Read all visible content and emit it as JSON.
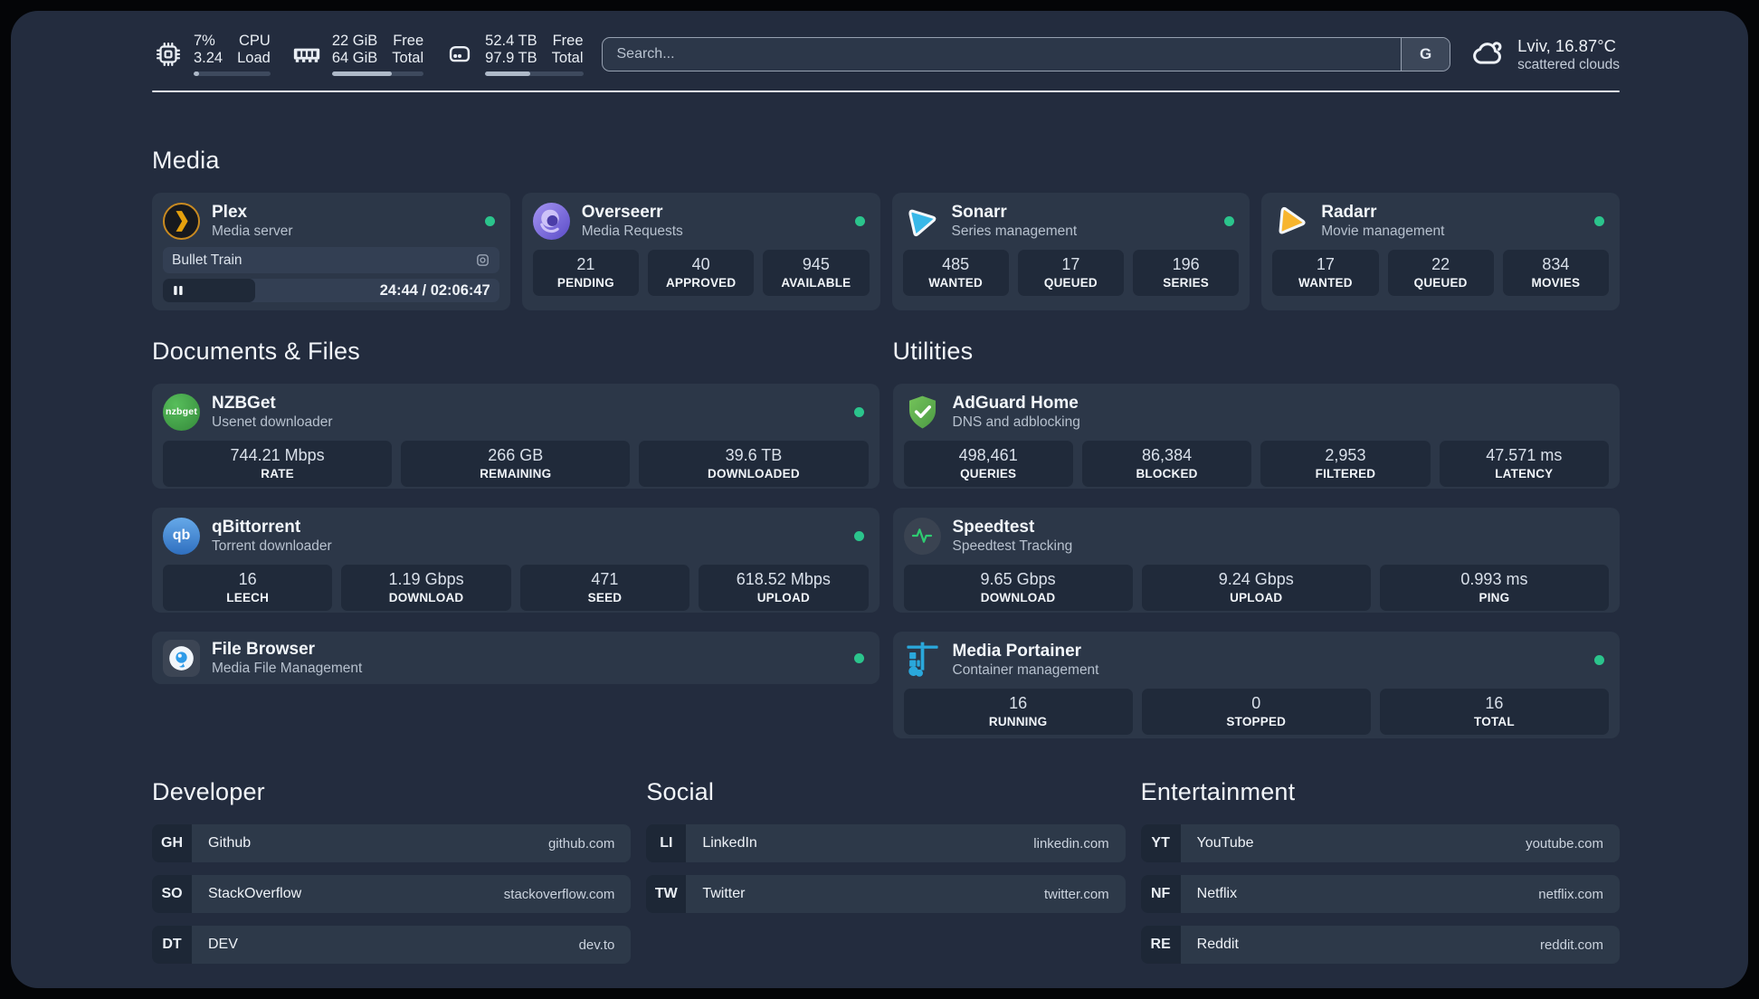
{
  "topbar": {
    "cpu": {
      "value_top": "7%",
      "value_bottom": "3.24",
      "label_top": "CPU",
      "label_bottom": "Load",
      "progress_pct": 7
    },
    "ram": {
      "value_top": "22 GiB",
      "value_bottom": "64 GiB",
      "label_top": "Free",
      "label_bottom": "Total",
      "progress_pct": 65
    },
    "disk": {
      "value_top": "52.4 TB",
      "value_bottom": "97.9 TB",
      "label_top": "Free",
      "label_bottom": "Total",
      "progress_pct": 46
    },
    "search": {
      "placeholder": "Search...",
      "button_label": "G"
    },
    "weather": {
      "location_temp": "Lviv, 16.87°C",
      "condition": "scattered clouds"
    }
  },
  "icon_text": {
    "nzbget": "nzbget",
    "qbittorrent": "qb"
  },
  "sections": {
    "media": {
      "title": "Media",
      "plex": {
        "title": "Plex",
        "subtitle": "Media server",
        "now_playing": {
          "title": "Bullet Train",
          "time": "24:44 / 02:06:47"
        }
      },
      "overseerr": {
        "title": "Overseerr",
        "subtitle": "Media Requests",
        "stats": [
          {
            "value": "21",
            "label": "PENDING"
          },
          {
            "value": "40",
            "label": "APPROVED"
          },
          {
            "value": "945",
            "label": "AVAILABLE"
          }
        ]
      },
      "sonarr": {
        "title": "Sonarr",
        "subtitle": "Series management",
        "stats": [
          {
            "value": "485",
            "label": "WANTED"
          },
          {
            "value": "17",
            "label": "QUEUED"
          },
          {
            "value": "196",
            "label": "SERIES"
          }
        ]
      },
      "radarr": {
        "title": "Radarr",
        "subtitle": "Movie management",
        "stats": [
          {
            "value": "17",
            "label": "WANTED"
          },
          {
            "value": "22",
            "label": "QUEUED"
          },
          {
            "value": "834",
            "label": "MOVIES"
          }
        ]
      }
    },
    "documents": {
      "title": "Documents & Files",
      "nzbget": {
        "title": "NZBGet",
        "subtitle": "Usenet downloader",
        "stats": [
          {
            "value": "744.21 Mbps",
            "label": "RATE"
          },
          {
            "value": "266 GB",
            "label": "REMAINING"
          },
          {
            "value": "39.6 TB",
            "label": "DOWNLOADED"
          }
        ]
      },
      "qbittorrent": {
        "title": "qBittorrent",
        "subtitle": "Torrent downloader",
        "stats": [
          {
            "value": "16",
            "label": "LEECH"
          },
          {
            "value": "1.19 Gbps",
            "label": "DOWNLOAD"
          },
          {
            "value": "471",
            "label": "SEED"
          },
          {
            "value": "618.52 Mbps",
            "label": "UPLOAD"
          }
        ]
      },
      "filebrowser": {
        "title": "File Browser",
        "subtitle": "Media File Management"
      }
    },
    "utilities": {
      "title": "Utilities",
      "adguard": {
        "title": "AdGuard Home",
        "subtitle": "DNS and adblocking",
        "stats": [
          {
            "value": "498,461",
            "label": "QUERIES"
          },
          {
            "value": "86,384",
            "label": "BLOCKED"
          },
          {
            "value": "2,953",
            "label": "FILTERED"
          },
          {
            "value": "47.571 ms",
            "label": "LATENCY"
          }
        ]
      },
      "speedtest": {
        "title": "Speedtest",
        "subtitle": "Speedtest Tracking",
        "stats": [
          {
            "value": "9.65 Gbps",
            "label": "DOWNLOAD"
          },
          {
            "value": "9.24 Gbps",
            "label": "UPLOAD"
          },
          {
            "value": "0.993 ms",
            "label": "PING"
          }
        ]
      },
      "portainer": {
        "title": "Media Portainer",
        "subtitle": "Container management",
        "stats": [
          {
            "value": "16",
            "label": "RUNNING"
          },
          {
            "value": "0",
            "label": "STOPPED"
          },
          {
            "value": "16",
            "label": "TOTAL"
          }
        ]
      }
    },
    "bookmarks": [
      {
        "title": "Developer",
        "items": [
          {
            "tag": "GH",
            "name": "Github",
            "url": "github.com"
          },
          {
            "tag": "SO",
            "name": "StackOverflow",
            "url": "stackoverflow.com"
          },
          {
            "tag": "DT",
            "name": "DEV",
            "url": "dev.to"
          }
        ]
      },
      {
        "title": "Social",
        "items": [
          {
            "tag": "LI",
            "name": "LinkedIn",
            "url": "linkedin.com"
          },
          {
            "tag": "TW",
            "name": "Twitter",
            "url": "twitter.com"
          }
        ]
      },
      {
        "title": "Entertainment",
        "items": [
          {
            "tag": "YT",
            "name": "YouTube",
            "url": "youtube.com"
          },
          {
            "tag": "NF",
            "name": "Netflix",
            "url": "netflix.com"
          },
          {
            "tag": "RE",
            "name": "Reddit",
            "url": "reddit.com"
          }
        ]
      }
    ]
  },
  "colors": {
    "panel_bg": "#232C3E",
    "card_bg": "#2C3748",
    "stat_bg": "#202A3A",
    "status_online_green": "#2BC48C",
    "plex_orange": "#E5A00D",
    "sonarr_blue": "#38B8E8",
    "radarr_yellow": "#F7B52E",
    "nzbget_green": "#43A047",
    "qbittorrent_blue": "#3D7DD8",
    "adguard_green": "#5FAE4A",
    "speedtest_green": "#2ECC71",
    "portainer_blue": "#2AA8DC",
    "overseerr_purple": "#7A68D8",
    "filebrowser_blue": "#2E9BE8"
  }
}
